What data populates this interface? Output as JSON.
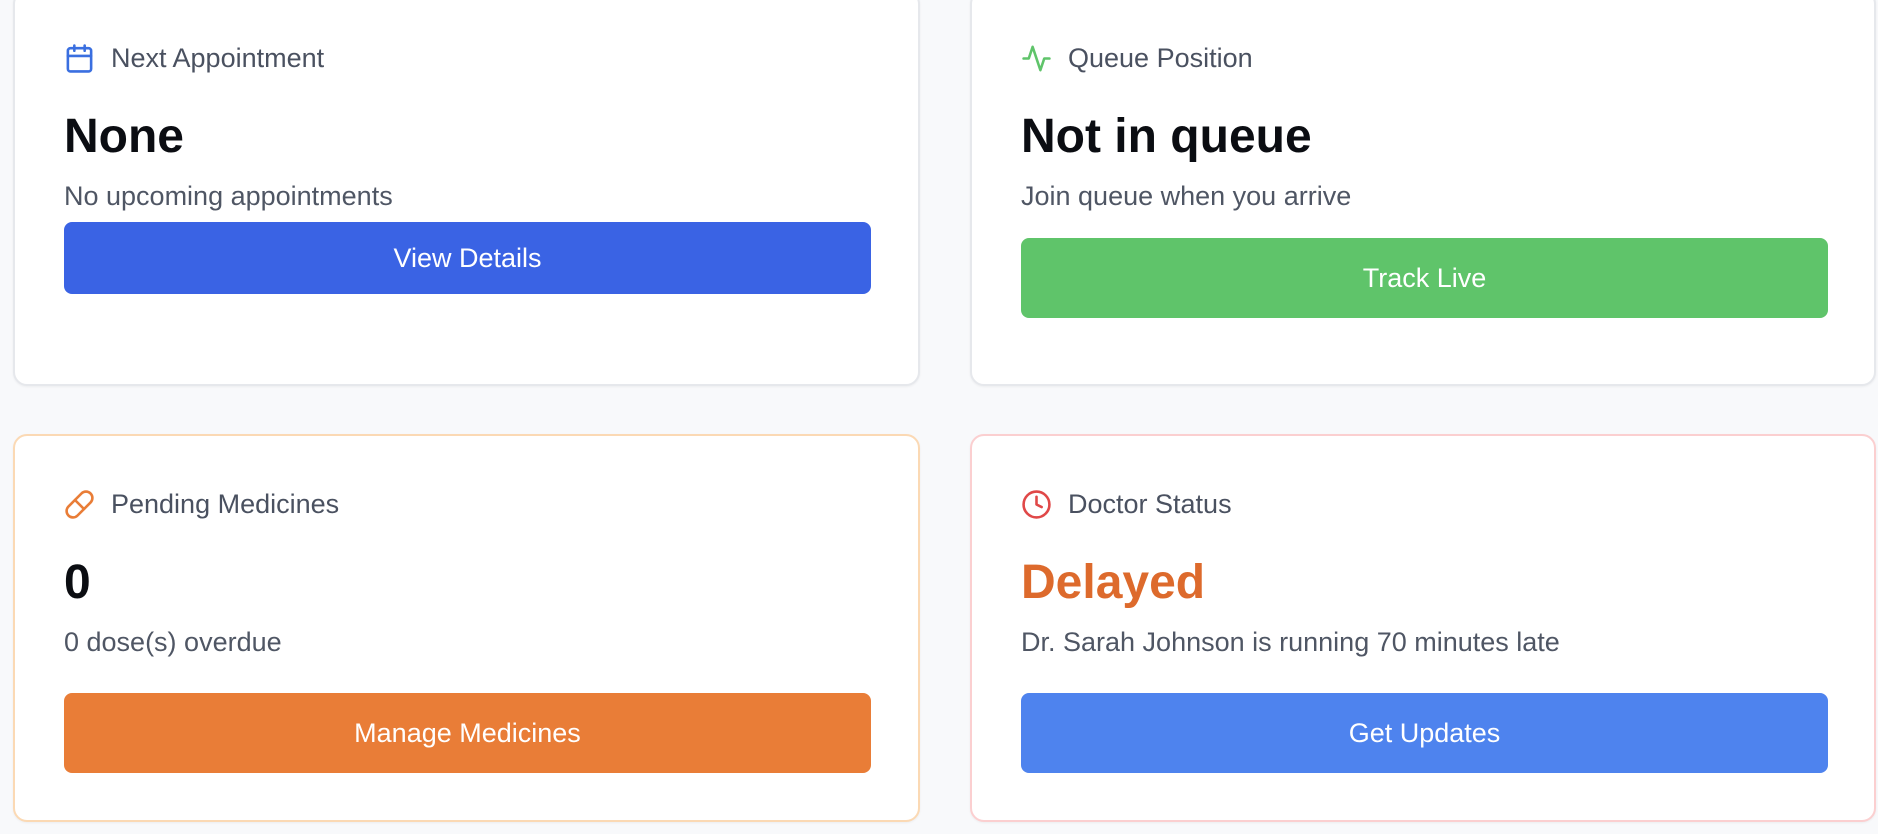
{
  "cards": [
    {
      "title": "Next Appointment",
      "icon": "calendar-icon",
      "icon_color": "#3a6fe0",
      "value": "None",
      "subtitle": "No upcoming appointments",
      "button_label": "View Details",
      "button_color": "#3a63e4"
    },
    {
      "title": "Queue Position",
      "icon": "activity-icon",
      "icon_color": "#5fc46a",
      "value": "Not in queue",
      "subtitle": "Join queue when you arrive",
      "button_label": "Track Live",
      "button_color": "#5fc46a"
    },
    {
      "title": "Pending Medicines",
      "icon": "pill-icon",
      "icon_color": "#e97d37",
      "value": "0",
      "subtitle": "0 dose(s) overdue",
      "button_label": "Manage Medicines",
      "button_color": "#e97d37"
    },
    {
      "title": "Doctor Status",
      "icon": "clock-icon",
      "icon_color": "#e04848",
      "value": "Delayed",
      "value_color": "#dd6a2c",
      "subtitle": "Dr. Sarah Johnson is running 70 minutes late",
      "button_label": "Get Updates",
      "button_color": "#4e83ee"
    }
  ]
}
